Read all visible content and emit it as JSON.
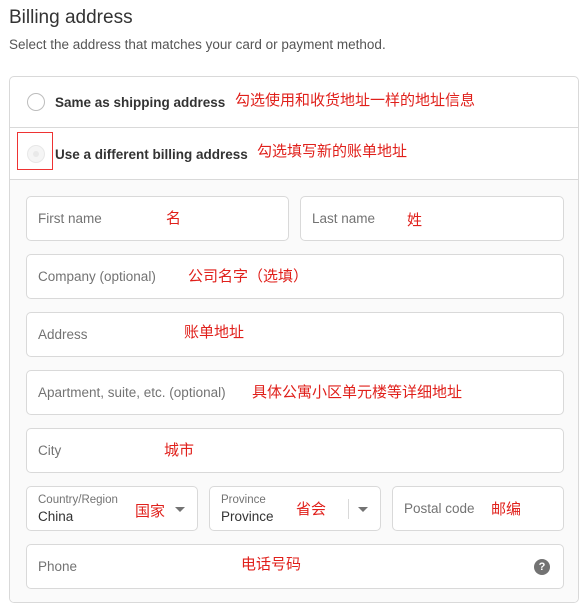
{
  "header": {
    "title": "Billing address",
    "subtitle": "Select the address that matches your card or payment method."
  },
  "options": [
    {
      "label": "Same as shipping address",
      "note": "勾选使用和收货地址一样的地址信息"
    },
    {
      "label": "Use a different billing address",
      "note": "勾选填写新的账单地址"
    }
  ],
  "fields": {
    "first_name": {
      "placeholder": "First name",
      "note": "名"
    },
    "last_name": {
      "placeholder": "Last name",
      "note": "姓"
    },
    "company": {
      "placeholder": "Company (optional)",
      "note": "公司名字（选填）"
    },
    "address": {
      "placeholder": "Address",
      "note": "账单地址"
    },
    "apartment": {
      "placeholder": "Apartment, suite, etc. (optional)",
      "note": "具体公寓小区单元楼等详细地址"
    },
    "city": {
      "placeholder": "City",
      "note": "城市"
    },
    "country": {
      "label": "Country/Region",
      "value": "China",
      "note": "国家"
    },
    "province": {
      "label": "Province",
      "value": "Province",
      "note": "省会"
    },
    "postal": {
      "placeholder": "Postal code",
      "note": "邮编"
    },
    "phone": {
      "placeholder": "Phone",
      "note": "电话号码",
      "help_icon": "?"
    }
  },
  "colors": {
    "annotation": "#e0201b",
    "border": "#d9d9d9"
  }
}
